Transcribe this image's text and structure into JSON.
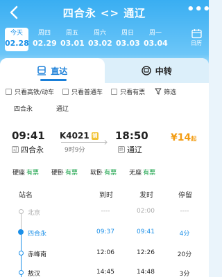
{
  "header": {
    "title": "四合永 <> 通辽"
  },
  "dates": [
    {
      "weekday": "今天",
      "date": "02.28",
      "selected": true
    },
    {
      "weekday": "周四",
      "date": "02.29"
    },
    {
      "weekday": "周五",
      "date": "03.01"
    },
    {
      "weekday": "周六",
      "date": "03.02"
    },
    {
      "weekday": "周日",
      "date": "03.03"
    },
    {
      "weekday": "周一",
      "date": "03.04"
    }
  ],
  "calendar_label": "日历",
  "tabs": {
    "direct": "直达",
    "transfer": "中转"
  },
  "filters": {
    "high_speed": "只看高铁/动车",
    "normal": "只看普通车",
    "has_ticket": "只看有票",
    "filter": "筛选"
  },
  "stations": {
    "from": "四合永",
    "to": "通辽"
  },
  "train": {
    "dep_time": "09:41",
    "dep_station": "四合永",
    "dep_mark": "过",
    "number": "K4021",
    "badge": "铺",
    "duration": "9时9分",
    "arr_time": "18:50",
    "arr_station": "通辽",
    "arr_mark": "终",
    "price": "¥14",
    "price_suffix": "起"
  },
  "seats": [
    {
      "type": "硬座",
      "status": "有票"
    },
    {
      "type": "硬卧",
      "status": "有票"
    },
    {
      "type": "软卧",
      "status": "有票"
    },
    {
      "type": "无座",
      "status": "有票"
    }
  ],
  "table": {
    "headers": [
      "站名",
      "到时",
      "发时",
      "停留"
    ],
    "rows": [
      {
        "station": "北京",
        "arrive": "----",
        "depart": "02:00",
        "stay": "----"
      },
      {
        "station": "四合永",
        "arrive": "09:37",
        "depart": "09:41",
        "stay": "4分"
      },
      {
        "station": "赤峰南",
        "arrive": "12:06",
        "depart": "12:26",
        "stay": "20分"
      },
      {
        "station": "敖汉",
        "arrive": "14:45",
        "depart": "14:48",
        "stay": "3分"
      }
    ]
  }
}
